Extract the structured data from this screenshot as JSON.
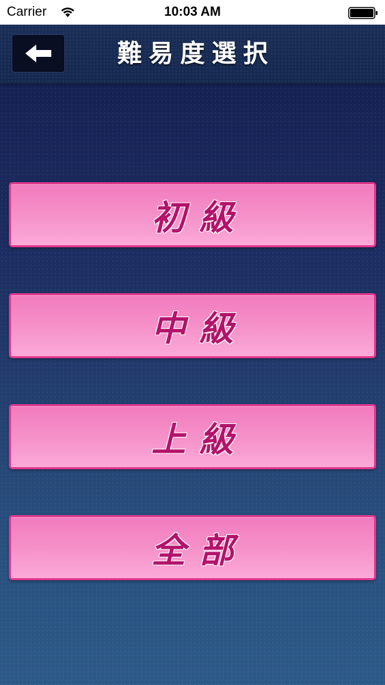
{
  "status_bar": {
    "carrier": "Carrier",
    "time": "10:03 AM"
  },
  "header": {
    "title": "難易度選択",
    "back_icon": "arrow-left-icon"
  },
  "levels": [
    {
      "label": "初級"
    },
    {
      "label": "中級"
    },
    {
      "label": "上級"
    },
    {
      "label": "全部"
    }
  ],
  "colors": {
    "button_fill": "#f590c9",
    "button_border": "#e2378f",
    "button_text": "#b3136a",
    "background_top": "#141b4c",
    "background_bottom": "#2c5a88"
  }
}
